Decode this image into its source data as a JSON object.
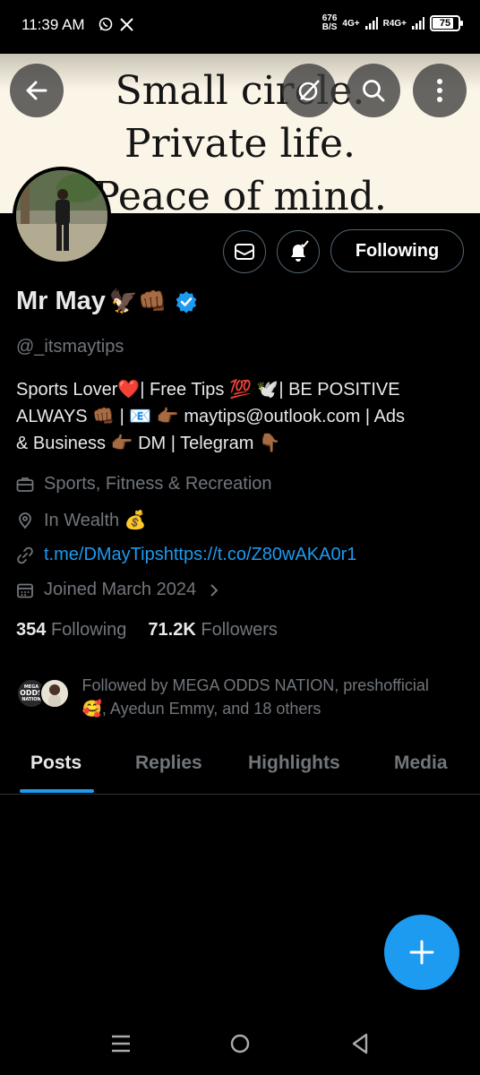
{
  "status_bar": {
    "time": "11:39 AM",
    "speed_value": "676",
    "speed_unit": "B/S",
    "net1": "4G+",
    "net2": "R4G+",
    "battery": "75"
  },
  "banner": {
    "lines": [
      "Small circle.",
      "Private life.",
      "Peace of mind."
    ]
  },
  "actions": {
    "follow_label": "Following"
  },
  "profile": {
    "name": "Mr May",
    "name_emoji": "🦅👊🏾",
    "handle": "@_itsmaytips",
    "bio_lines": [
      "Sports Lover❤️| Free Tips 💯 🕊️| BE POSITIVE",
      "ALWAYS 👊🏾 | 📧 👉🏾 maytips@outlook.com | Ads",
      "& Business 👉🏾 DM | Telegram 👇🏾"
    ],
    "category": "Sports, Fitness & Recreation",
    "location": "In Wealth 💰",
    "link": "t.me/DMayTipshttps://t.co/Z80wAKA0r1",
    "joined": "Joined March 2024",
    "following_count": "354",
    "following_label": "Following",
    "followers_count": "71.2K",
    "followers_label": "Followers",
    "followed_by_line1": "Followed by MEGA ODDS NATION, preshofficial",
    "followed_by_line2": "🥰, Ayedun Emmy, and 18 others",
    "follower_avatar_text": [
      "MEGA",
      "ODDS",
      "NATION"
    ]
  },
  "tabs": [
    {
      "label": "Posts",
      "active": true
    },
    {
      "label": "Replies",
      "active": false
    },
    {
      "label": "Highlights",
      "active": false
    },
    {
      "label": "Media",
      "active": false
    }
  ],
  "colors": {
    "accent": "#1d9bf0",
    "muted": "#71767b",
    "text": "#e7e9ea",
    "border": "#536471"
  },
  "icons": [
    "back-arrow-icon",
    "grok-icon",
    "search-icon",
    "more-vertical-icon",
    "mail-icon",
    "bell-icon",
    "verified-badge-icon",
    "briefcase-icon",
    "location-pin-icon",
    "link-icon",
    "calendar-icon",
    "chevron-right-icon",
    "plus-icon",
    "recents-icon",
    "home-icon",
    "back-icon"
  ]
}
